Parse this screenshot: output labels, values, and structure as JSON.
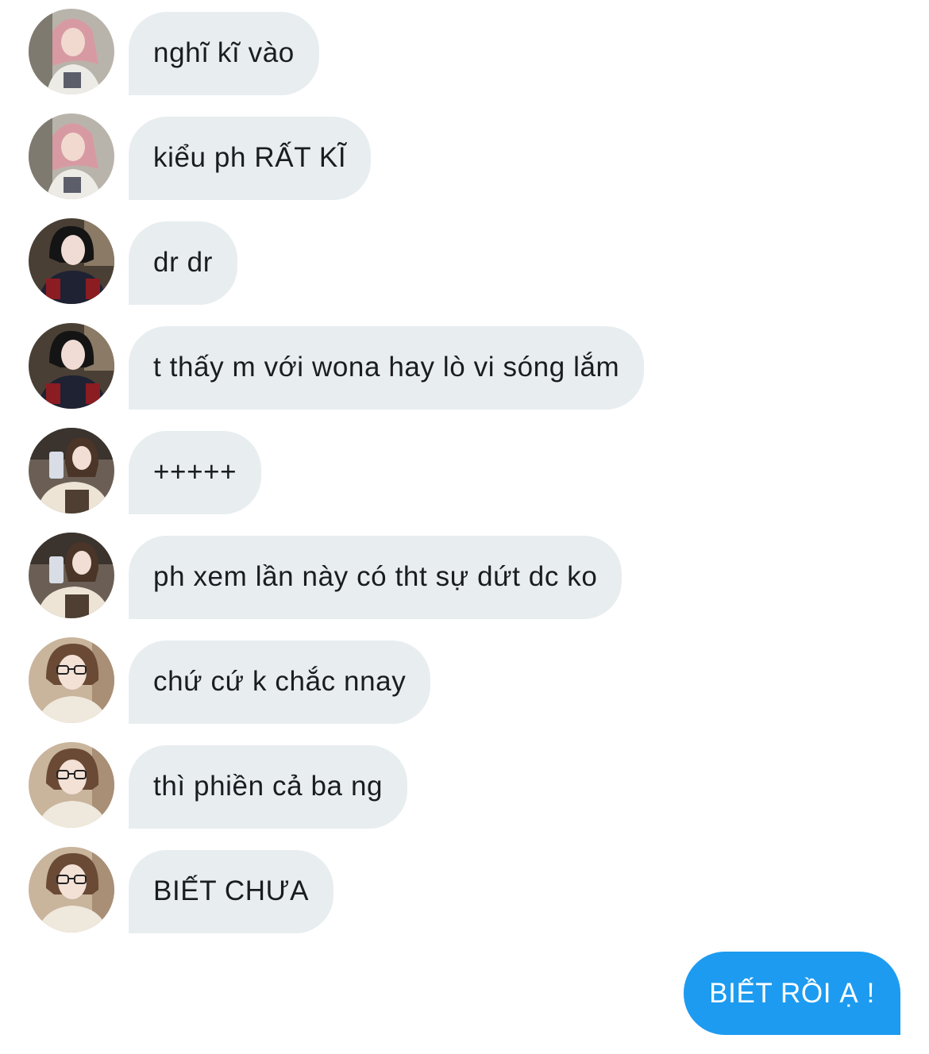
{
  "messages": [
    {
      "sender": "pink-hair",
      "text": "nghĩ kĩ vào"
    },
    {
      "sender": "pink-hair",
      "text": "kiểu ph RẤT KĨ"
    },
    {
      "sender": "black-bob",
      "text": "dr dr"
    },
    {
      "sender": "black-bob",
      "text": "t thấy m với wona hay lò vi sóng lắm"
    },
    {
      "sender": "mirror-selfie",
      "text": "+++++"
    },
    {
      "sender": "mirror-selfie",
      "text": "ph xem lần này có tht sự dứt dc ko"
    },
    {
      "sender": "glasses",
      "text": "chứ cứ k chắc nnay"
    },
    {
      "sender": "glasses",
      "text": "thì phiền cả ba ng"
    },
    {
      "sender": "glasses",
      "text": "BIẾT CHƯA"
    }
  ],
  "outgoing": {
    "text": "BIẾT RỒI Ạ !"
  },
  "colors": {
    "incoming_bubble": "#e8edf0",
    "incoming_text": "#1a1d20",
    "outgoing_bubble": "#1d9bf0",
    "outgoing_text": "#ffffff"
  }
}
